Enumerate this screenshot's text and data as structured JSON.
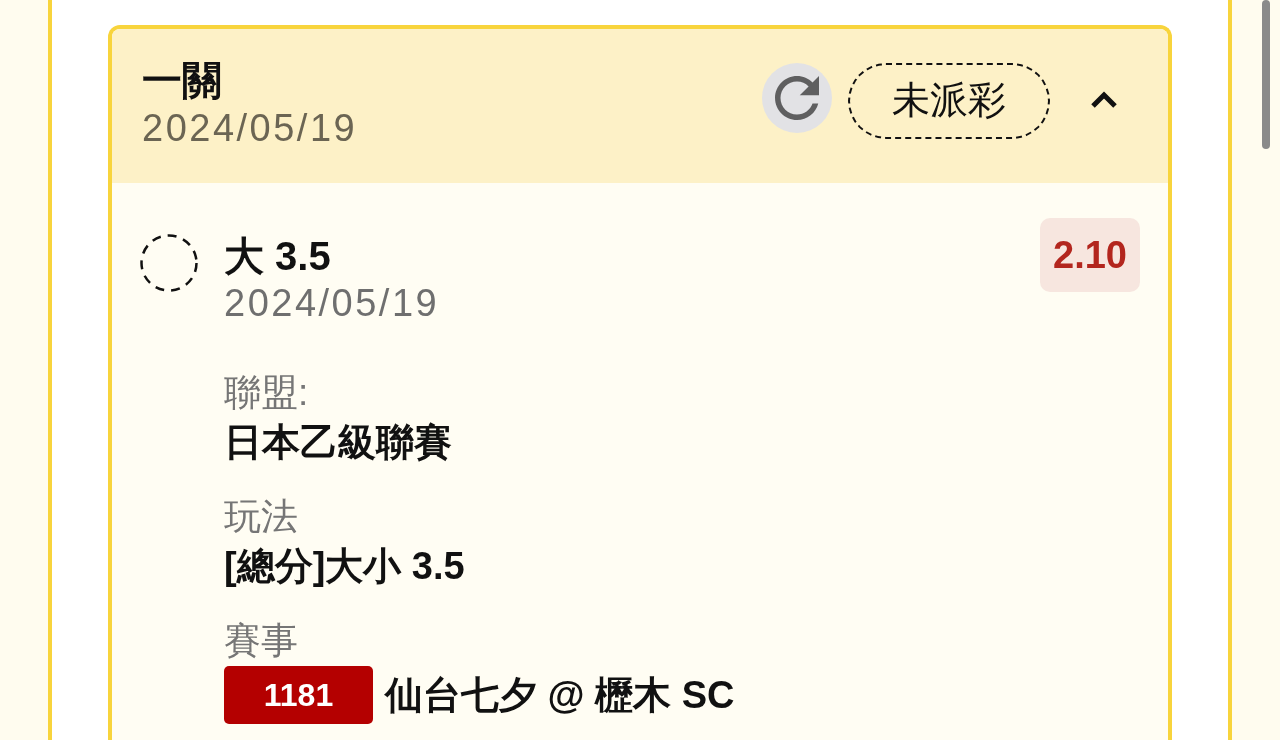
{
  "bet": {
    "title": "一關",
    "date": "2024/05/19",
    "status": "未派彩",
    "expanded": true,
    "selections": [
      {
        "pick": "大 3.5",
        "date": "2024/05/19",
        "odds": "2.10",
        "fields": [
          {
            "kind": "text",
            "label": "聯盟:",
            "value": "日本乙級聯賽"
          },
          {
            "kind": "text",
            "label": "玩法",
            "value": "[總分]大小 3.5"
          },
          {
            "kind": "match",
            "label": "賽事",
            "match_number": "1181",
            "value": "仙台七夕 @ 櫪木 SC"
          }
        ]
      }
    ]
  }
}
